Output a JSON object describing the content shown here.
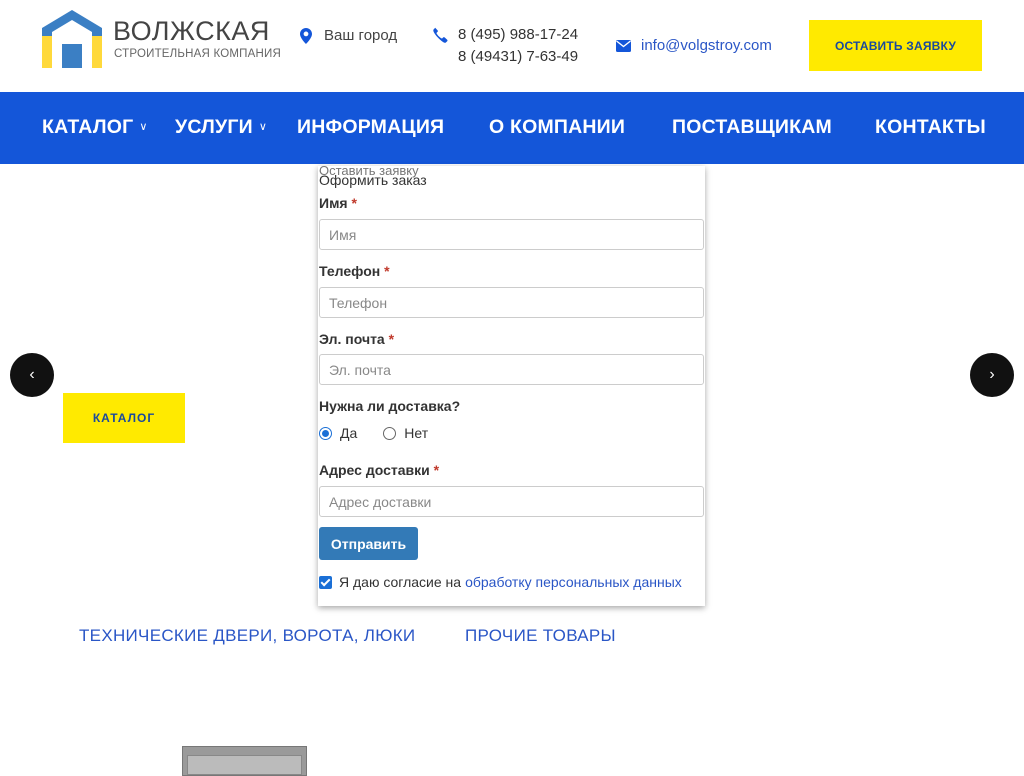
{
  "header": {
    "brand_name": "ВОЛЖСКАЯ",
    "brand_sub": "СТРОИТЕЛЬНАЯ КОМПАНИЯ",
    "city": "Ваш город",
    "phones": [
      "8 (495) 988-17-24",
      "8 (49431) 7-63-49"
    ],
    "email": "info@volgstroy.com",
    "cta_label": "ОСТАВИТЬ ЗАЯВКУ"
  },
  "nav": {
    "items": [
      {
        "label": "КАТАЛОГ",
        "has_dropdown": true
      },
      {
        "label": "УСЛУГИ",
        "has_dropdown": true
      },
      {
        "label": "ИНФОРМАЦИЯ",
        "has_dropdown": false
      },
      {
        "label": "О КОМПАНИИ",
        "has_dropdown": false
      },
      {
        "label": "ПОСТАВЩИКАМ",
        "has_dropdown": false
      },
      {
        "label": "КОНТАКТЫ",
        "has_dropdown": false
      }
    ]
  },
  "slider": {
    "prev_icon": "‹",
    "next_icon": "›",
    "catalog_button": "КАТАЛОГ"
  },
  "order_form": {
    "ghost_title": "Оставить заявку",
    "title": "Оформить заказ",
    "fields": {
      "name_label": "Имя",
      "name_placeholder": "Имя",
      "phone_label": "Телефон",
      "phone_placeholder": "Телефон",
      "email_label": "Эл. почта",
      "email_placeholder": "Эл. почта",
      "delivery_question": "Нужна ли доставка?",
      "delivery_yes": "Да",
      "delivery_no": "Нет",
      "delivery_selected": "Да",
      "address_label": "Адрес доставки",
      "address_placeholder": "Адрес доставки"
    },
    "required_mark": "*",
    "submit_label": "Отправить",
    "consent_text": "Я даю согласие на",
    "consent_link": "обработку персональных данных",
    "consent_checked": true
  },
  "catalog_tabs": [
    "ТЕХНИЧЕСКИЕ ДВЕРИ, ВОРОТА, ЛЮКИ",
    "ПРОЧИЕ ТОВАРЫ"
  ],
  "colors": {
    "nav_blue": "#1456d9",
    "accent_yellow": "#ffea00",
    "link_blue": "#2a56c6",
    "submit_blue": "#337ab7"
  }
}
